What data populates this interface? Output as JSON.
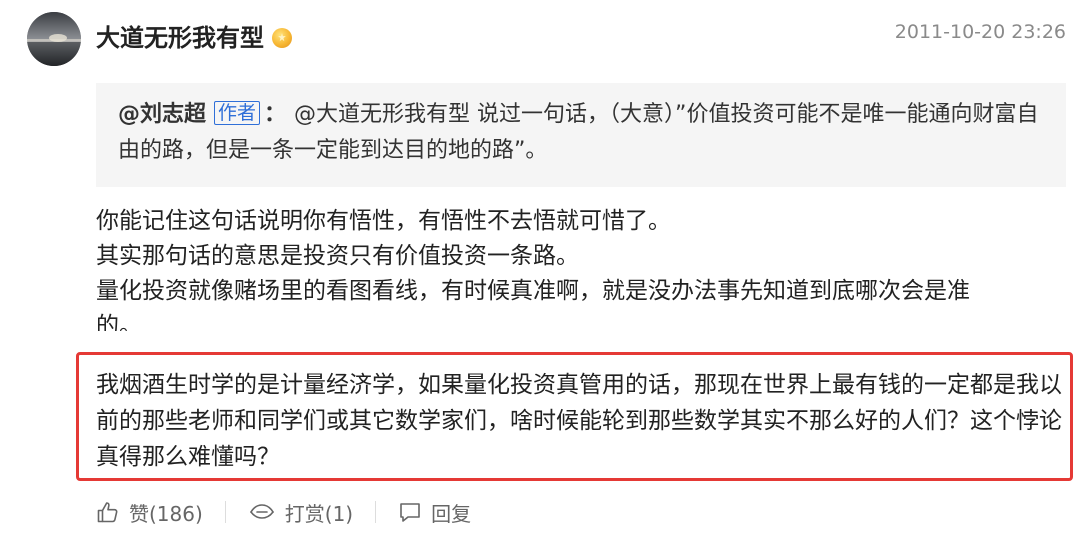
{
  "comment": {
    "username": "大道无形我有型",
    "timestamp": "2011-10-20 23:26",
    "quote": {
      "author": "@刘志超",
      "author_tag": "作者",
      "colon": "：",
      "text": "@大道无形我有型 说过一句话，（大意）”价值投资可能不是唯一能通向财富自由的路，但是一条一定能到达目的地的路”。"
    },
    "paragraphs": [
      "你能记住这句话说明你有悟性，有悟性不去悟就可惜了。",
      "其实那句话的意思是投资只有价值投资一条路。",
      "量化投资就像赌场里的看图看线，有时候真准啊，就是没办法事先知道到底哪次会是准",
      "的。"
    ],
    "highlighted": "我烟酒生时学的是计量经济学，如果量化投资真管用的话，那现在世界上最有钱的一定都是我以前的那些老师和同学们或其它数学家们，啥时候能轮到那些数学其实不那么好的人们？这个悖论真得那么难懂吗？"
  },
  "actions": {
    "like_label": "赞(186)",
    "tip_label": "打赏(1)",
    "reply_label": "回复"
  },
  "icons": {
    "like": "thumbs-up-icon",
    "tip": "reward-icon",
    "reply": "comment-icon",
    "badge": "vip-badge-icon"
  },
  "colors": {
    "highlight_border": "#e53935",
    "author_tag": "#2f6fd8",
    "quote_bg": "#f5f5f5"
  }
}
